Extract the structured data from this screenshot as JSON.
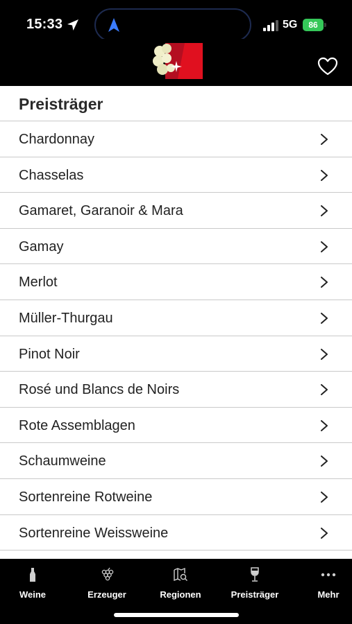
{
  "status_bar": {
    "time": "15:33",
    "network": "5G",
    "battery": "86"
  },
  "header": {
    "favorite_icon": "heart-outline-icon"
  },
  "list": {
    "title": "Preisträger",
    "items": [
      {
        "label": "Chardonnay"
      },
      {
        "label": "Chasselas"
      },
      {
        "label": "Gamaret, Garanoir & Mara"
      },
      {
        "label": "Gamay"
      },
      {
        "label": "Merlot"
      },
      {
        "label": "Müller-Thurgau"
      },
      {
        "label": "Pinot Noir"
      },
      {
        "label": "Rosé und Blancs de Noirs"
      },
      {
        "label": "Rote Assemblagen"
      },
      {
        "label": "Schaumweine"
      },
      {
        "label": "Sortenreine Rotweine"
      },
      {
        "label": "Sortenreine Weissweine"
      }
    ]
  },
  "tabs": [
    {
      "label": "Weine",
      "icon": "bottle-icon"
    },
    {
      "label": "Erzeuger",
      "icon": "grapes-icon"
    },
    {
      "label": "Regionen",
      "icon": "map-search-icon"
    },
    {
      "label": "Preisträger",
      "icon": "wine-glass-icon"
    },
    {
      "label": "Mehr",
      "icon": "more-dots-icon"
    }
  ],
  "colors": {
    "battery": "#35c759",
    "logo_red": "#e0101f",
    "island_border": "#1d2a4f"
  }
}
